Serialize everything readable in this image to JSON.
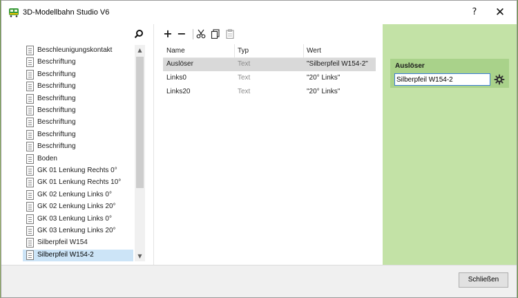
{
  "window": {
    "title": "3D-Modellbahn Studio V6",
    "help_label": "?",
    "close_label": "✕"
  },
  "objects": {
    "items": [
      {
        "label": "Beschleunigungskontakt"
      },
      {
        "label": "Beschriftung"
      },
      {
        "label": "Beschriftung"
      },
      {
        "label": "Beschriftung"
      },
      {
        "label": "Beschriftung"
      },
      {
        "label": "Beschriftung"
      },
      {
        "label": "Beschriftung"
      },
      {
        "label": "Beschriftung"
      },
      {
        "label": "Beschriftung"
      },
      {
        "label": "Boden"
      },
      {
        "label": "GK 01  Lenkung Rechts 0°"
      },
      {
        "label": "GK 01 Lenkung Rechts 10°"
      },
      {
        "label": "GK 02 Lenkung Links 0°"
      },
      {
        "label": "GK 02 Lenkung Links 20°"
      },
      {
        "label": "GK 03 Lenkung Links 0°"
      },
      {
        "label": "GK 03 Lenkung Links 20°"
      },
      {
        "label": "Silberpfeil W154"
      },
      {
        "label": "Silberpfeil W154-2"
      }
    ],
    "selected_label": "Silberpfeil W154-2"
  },
  "toolbar": {
    "add_label": "+",
    "remove_label": "−"
  },
  "properties": {
    "headers": {
      "name": "Name",
      "type": "Typ",
      "value": "Wert"
    },
    "rows": [
      {
        "name": "Auslöser",
        "type": "Text",
        "value": "\"Silberpfeil W154-2\""
      },
      {
        "name": "Links0",
        "type": "Text",
        "value": "\"20° Links\""
      },
      {
        "name": "Links20",
        "type": "Text",
        "value": "\"20° Links\""
      }
    ]
  },
  "editor": {
    "label": "Auslöser",
    "value": "Silberpfeil W154-2"
  },
  "footer": {
    "close_button_label": "Schließen"
  },
  "colors": {
    "panel_green": "#c3e2a6",
    "selection_blue": "#cce4f7",
    "input_border": "#3a7bd5"
  }
}
